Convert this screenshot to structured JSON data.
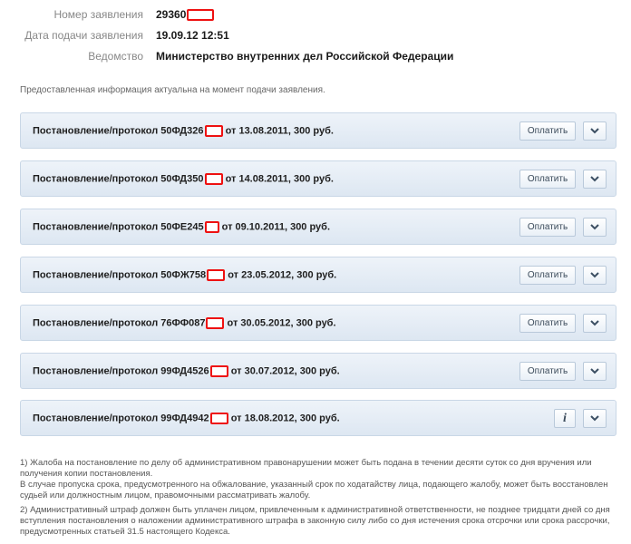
{
  "application": {
    "number_label": "Номер заявления",
    "number_value": "29360",
    "date_label": "Дата подачи заявления",
    "date_value": "19.09.12 12:51",
    "dept_label": "Ведомство",
    "dept_value": "Министерство внутренних дел Российской Федерации"
  },
  "notice": "Предоставленная информация актуальна на момент подачи заявления.",
  "decisions": [
    {
      "prefix": "Постановление/протокол 50ФД326",
      "suffix": "от 13.08.2011, 300 руб.",
      "action": "Оплатить"
    },
    {
      "prefix": "Постановление/протокол 50ФД350",
      "suffix": "от 14.08.2011, 300 руб.",
      "action": "Оплатить"
    },
    {
      "prefix": "Постановление/протокол 50ФЕ245",
      "suffix": "от 09.10.2011, 300 руб.",
      "action": "Оплатить"
    },
    {
      "prefix": "Постановление/протокол 50ФЖ758",
      "suffix": "от 23.05.2012, 300 руб.",
      "action": "Оплатить"
    },
    {
      "prefix": "Постановление/протокол 76ФФ087",
      "suffix": "от 30.05.2012, 300 руб.",
      "action": "Оплатить"
    },
    {
      "prefix": "Постановление/протокол 99ФД4526",
      "suffix": "от 30.07.2012, 300 руб.",
      "action": "Оплатить"
    },
    {
      "prefix": "Постановление/протокол 99ФД4942",
      "suffix": "от 18.08.2012, 300 руб.",
      "action": "i"
    }
  ],
  "footnotes": {
    "f1_line1": "1) Жалоба на постановление по делу об административном правонарушении может быть подана в течении десяти суток со дня вручения или получения копии постановления.",
    "f1_line2": "В случае пропуска срока, предусмотренного на обжалование, указанный срок по ходатайству лица, подающего жалобу, может быть восстановлен судьей или должностным лицом, правомочными рассматривать жалобу.",
    "f2": "2) Административный штраф должен быть уплачен лицом, привлеченным к административной ответственности, не позднее тридцати дней со дня вступления постановления о наложении административного штрафа в законную силу либо со дня истечения срока отсрочки или срока рассрочки, предусмотренных статьей 31.5 настоящего Кодекса."
  },
  "colors": {
    "redaction": "#e11111",
    "panel_bg": "#dde7f2",
    "panel_border": "#c9d7e6"
  }
}
